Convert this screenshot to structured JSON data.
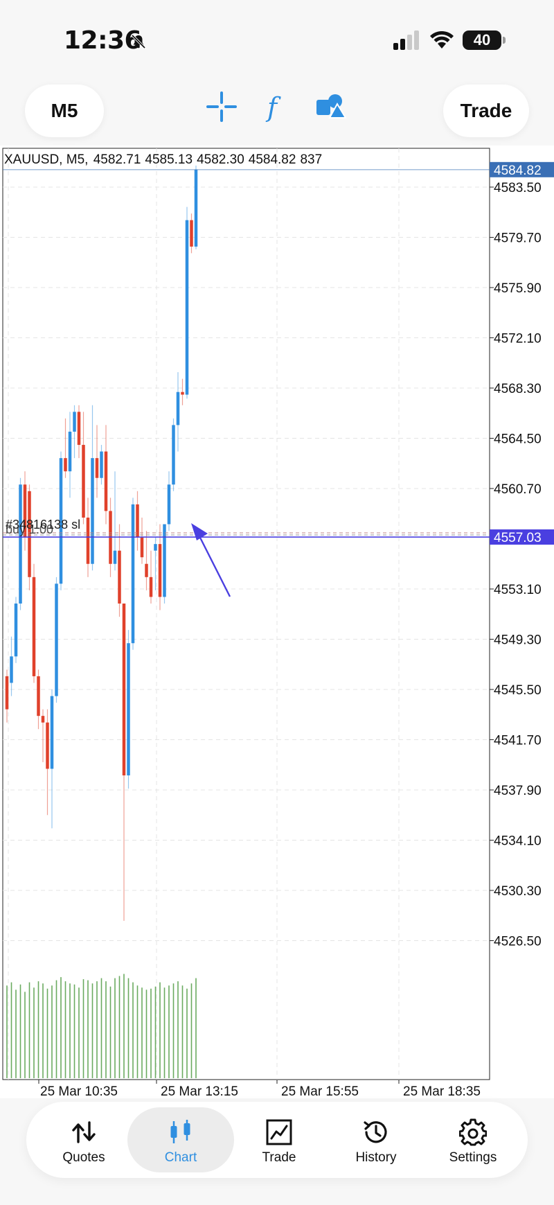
{
  "status_bar": {
    "time": "12:36",
    "battery": "40"
  },
  "toolbar": {
    "timeframe": "M5",
    "trade_label": "Trade"
  },
  "chart": {
    "ohlc_header": {
      "symbol_tf": "XAUUSD, M5,",
      "open": "4582.71",
      "high": "4585.13",
      "low": "4582.30",
      "close": "4584.82",
      "volume": "837"
    },
    "current_price_label": "4584.82",
    "position_price_label": "4557.03",
    "position_label": "#34816138 sl",
    "position_sub": "buy 1.00",
    "colors": {
      "bull": "#2f8fe0",
      "bear": "#e0412b",
      "volume": "#6aaa5f",
      "position": "#4a3fe0",
      "price_tag": "#3a6fb5"
    }
  },
  "chart_data": {
    "type": "candlestick",
    "symbol": "XAUUSD",
    "timeframe": "M5",
    "y_ticks": [
      "4583.50",
      "4579.70",
      "4575.90",
      "4572.10",
      "4568.30",
      "4564.50",
      "4560.70",
      "4557.03",
      "4553.10",
      "4549.30",
      "4545.50",
      "4541.70",
      "4537.90",
      "4534.10",
      "4530.30",
      "4526.50"
    ],
    "y_tick_values": [
      4583.5,
      4579.7,
      4575.9,
      4572.1,
      4568.3,
      4564.5,
      4560.7,
      4553.1,
      4549.3,
      4545.5,
      4541.7,
      4537.9,
      4534.1,
      4530.3,
      4526.5
    ],
    "ylim": [
      4524.0,
      4586.6
    ],
    "x_ticks": [
      "25 Mar 10:35",
      "25 Mar 13:15",
      "25 Mar 15:55",
      "25 Mar 18:35"
    ],
    "current_price": 4584.82,
    "position_price": 4557.03,
    "candles": [
      [
        4546.5,
        4547.0,
        4543.0,
        4544.0
      ],
      [
        4546.0,
        4549.5,
        4545.0,
        4548.0
      ],
      [
        4548.0,
        4552.5,
        4547.5,
        4552.0
      ],
      [
        4552.0,
        4561.5,
        4551.5,
        4561.0
      ],
      [
        4561.0,
        4562.0,
        4556.0,
        4557.0
      ],
      [
        4560.5,
        4561.0,
        4553.0,
        4554.0
      ],
      [
        4554.0,
        4555.0,
        4546.0,
        4546.5
      ],
      [
        4546.5,
        4547.0,
        4542.5,
        4543.5
      ],
      [
        4543.5,
        4544.0,
        4540.0,
        4543.0
      ],
      [
        4543.0,
        4544.0,
        4536.0,
        4539.5
      ],
      [
        4539.5,
        4545.5,
        4535.0,
        4545.0
      ],
      [
        4545.0,
        4554.0,
        4544.5,
        4553.5
      ],
      [
        4553.5,
        4563.5,
        4553.0,
        4563.0
      ],
      [
        4563.0,
        4566.0,
        4561.5,
        4562.0
      ],
      [
        4562.0,
        4566.5,
        4560.0,
        4565.0
      ],
      [
        4565.0,
        4567.0,
        4563.0,
        4566.5
      ],
      [
        4566.5,
        4567.0,
        4563.0,
        4564.0
      ],
      [
        4564.0,
        4566.5,
        4558.0,
        4558.5
      ],
      [
        4558.5,
        4560.0,
        4554.0,
        4555.0
      ],
      [
        4555.0,
        4567.0,
        4554.5,
        4563.0
      ],
      [
        4563.0,
        4565.5,
        4560.0,
        4561.5
      ],
      [
        4561.5,
        4564.0,
        4561.0,
        4563.5
      ],
      [
        4563.5,
        4565.5,
        4558.0,
        4559.0
      ],
      [
        4559.0,
        4560.0,
        4554.0,
        4555.0
      ],
      [
        4555.0,
        4562.0,
        4554.5,
        4556.0
      ],
      [
        4556.0,
        4558.0,
        4551.0,
        4552.0
      ],
      [
        4552.0,
        4549.0,
        4528.0,
        4539.0
      ],
      [
        4539.0,
        4550.0,
        4538.0,
        4549.0
      ],
      [
        4549.0,
        4560.0,
        4548.5,
        4559.5
      ],
      [
        4559.5,
        4560.5,
        4556.0,
        4557.0
      ],
      [
        4557.0,
        4558.5,
        4555.0,
        4555.5
      ],
      [
        4555.0,
        4557.5,
        4553.0,
        4554.0
      ],
      [
        4554.0,
        4556.0,
        4552.0,
        4552.5
      ],
      [
        4556.0,
        4557.0,
        4553.0,
        4556.5
      ],
      [
        4556.5,
        4558.0,
        4551.5,
        4552.5
      ],
      [
        4552.5,
        4558.0,
        4552.0,
        4558.0
      ],
      [
        4558.0,
        4562.0,
        4557.5,
        4561.0
      ],
      [
        4561.0,
        4566.0,
        4560.5,
        4565.5
      ],
      [
        4565.5,
        4569.5,
        4563.5,
        4568.0
      ],
      [
        4568.0,
        4569.0,
        4567.0,
        4567.8
      ],
      [
        4567.8,
        4582.0,
        4567.5,
        4581.0
      ],
      [
        4581.0,
        4581.5,
        4578.5,
        4579.0
      ],
      [
        4579.0,
        4585.13,
        4578.8,
        4584.82
      ]
    ],
    "volumes": [
      0.88,
      0.91,
      0.84,
      0.89,
      0.82,
      0.91,
      0.86,
      0.92,
      0.9,
      0.85,
      0.88,
      0.93,
      0.96,
      0.92,
      0.9,
      0.89,
      0.86,
      0.94,
      0.93,
      0.9,
      0.92,
      0.95,
      0.92,
      0.87,
      0.95,
      0.97,
      0.99,
      0.95,
      0.91,
      0.88,
      0.86,
      0.84,
      0.85,
      0.87,
      0.91,
      0.86,
      0.88,
      0.9,
      0.92,
      0.88,
      0.85,
      0.9,
      0.95
    ]
  },
  "tabbar": {
    "tabs": [
      {
        "label": "Quotes"
      },
      {
        "label": "Chart"
      },
      {
        "label": "Trade"
      },
      {
        "label": "History"
      },
      {
        "label": "Settings"
      }
    ]
  }
}
